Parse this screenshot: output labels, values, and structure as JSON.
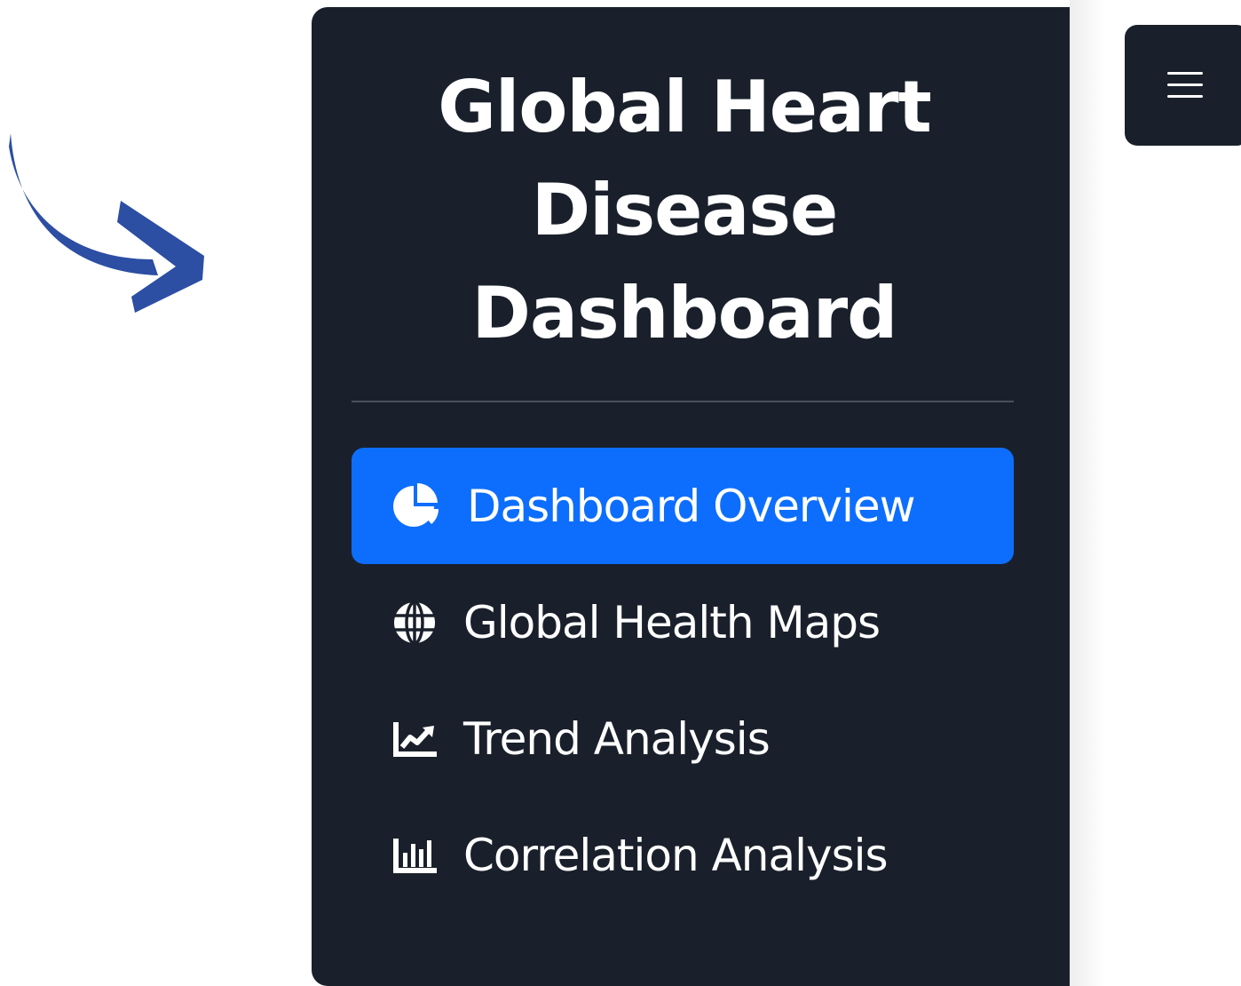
{
  "sidebar": {
    "title": "Global Heart Disease Dashboard",
    "nav_items": [
      {
        "label": "Dashboard Overview",
        "icon": "pie-chart-icon",
        "active": true
      },
      {
        "label": "Global Health Maps",
        "icon": "globe-icon",
        "active": false
      },
      {
        "label": "Trend Analysis",
        "icon": "line-chart-icon",
        "active": false
      },
      {
        "label": "Correlation Analysis",
        "icon": "bar-chart-icon",
        "active": false
      }
    ]
  },
  "toggle_button": {
    "icon": "hamburger-menu-icon"
  },
  "decoration": {
    "arrow_icon": "curved-arrow-icon"
  },
  "colors": {
    "sidebar_bg": "#1a202b",
    "active_bg": "#0d6efd",
    "arrow": "#2c4ea3",
    "text": "#ffffff"
  }
}
